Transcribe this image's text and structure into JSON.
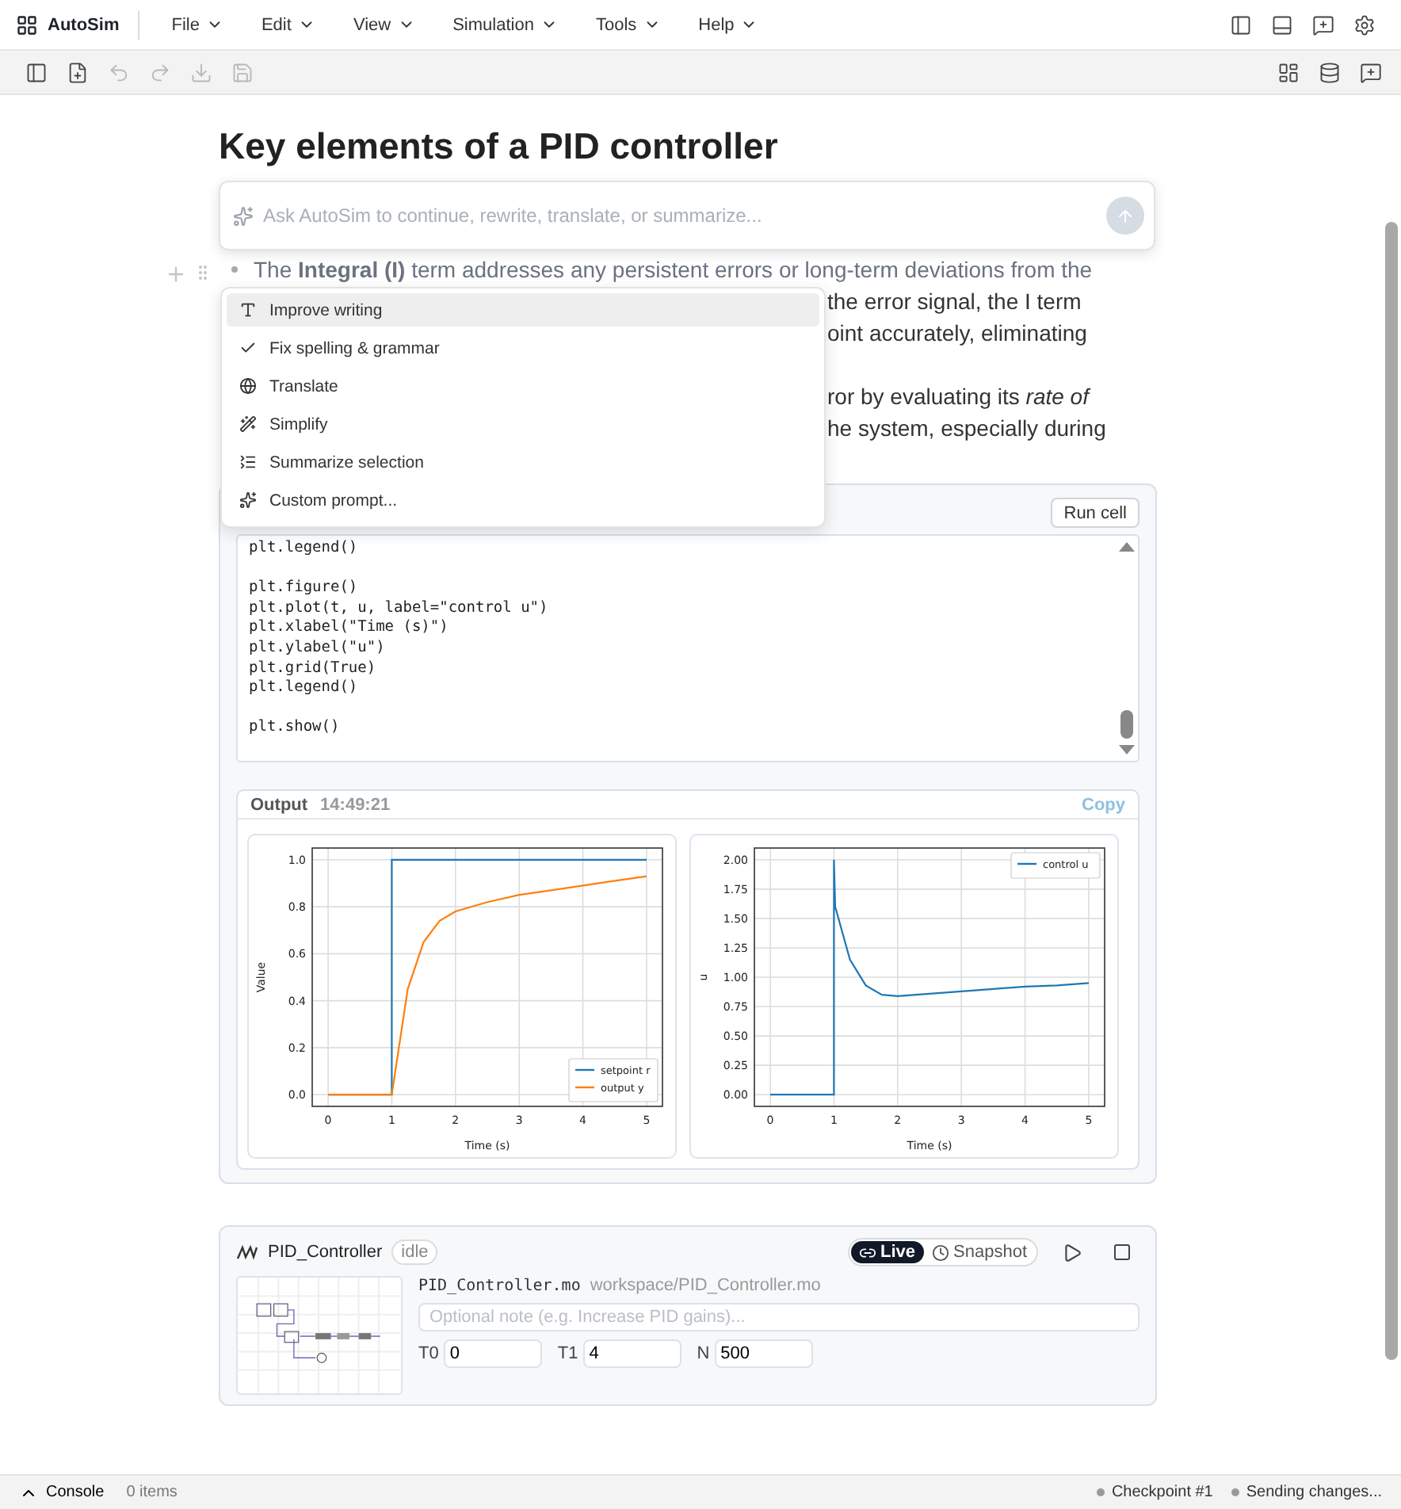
{
  "app": {
    "name": "AutoSim"
  },
  "menus": [
    "File",
    "Edit",
    "View",
    "Simulation",
    "Tools",
    "Help"
  ],
  "title_bar_actions": [
    {
      "kind": "panel-left"
    },
    {
      "kind": "panel-bottom"
    },
    {
      "kind": "chat"
    },
    {
      "kind": "settings"
    }
  ],
  "toolbar_left": [
    {
      "kind": "sidebar",
      "disabled": false
    },
    {
      "kind": "new-file",
      "disabled": false
    },
    {
      "kind": "undo",
      "disabled": true
    },
    {
      "kind": "redo",
      "disabled": true
    },
    {
      "kind": "download",
      "disabled": true
    },
    {
      "kind": "save",
      "disabled": true
    }
  ],
  "toolbar_right": [
    {
      "kind": "layout"
    },
    {
      "kind": "database"
    },
    {
      "kind": "chat"
    }
  ],
  "document": {
    "title": "Key elements of a PID controller",
    "lines": [
      {
        "kind": "bullet",
        "text": "The **Integral (I)** term addresses any persistent errors or long-term deviations from the"
      },
      {
        "kind": "fragment",
        "text": "the error signal, the I term"
      },
      {
        "kind": "fragment",
        "text": "oint accurately, eliminating"
      },
      {
        "kind": "gap"
      },
      {
        "kind": "fragment",
        "text": "ror by evaluating its *rate of*"
      },
      {
        "kind": "fragment",
        "text": "he system, especially during"
      }
    ]
  },
  "ai_prompt": {
    "placeholder": "Ask AutoSim to continue, rewrite, translate, or summarize..."
  },
  "ai_menu": [
    {
      "kind": "improve",
      "label": "Improve writing",
      "selected": true
    },
    {
      "kind": "spelling",
      "label": "Fix spelling & grammar",
      "selected": false
    },
    {
      "kind": "translate",
      "label": "Translate",
      "selected": false
    },
    {
      "kind": "simplify",
      "label": "Simplify",
      "selected": false
    },
    {
      "kind": "summarize",
      "label": "Summarize selection",
      "selected": false
    },
    {
      "kind": "custom",
      "label": "Custom prompt...",
      "selected": false
    }
  ],
  "code_cell": {
    "run_button": "Run cell",
    "code_blocks": [
      [
        "plt.legend()"
      ],
      [
        "plt.figure()",
        "plt.plot(t, u, label=\"control u\")",
        "plt.xlabel(\"Time (s)\")",
        "plt.ylabel(\"u\")",
        "plt.grid(True)",
        "plt.legend()"
      ],
      [
        "plt.show()"
      ]
    ],
    "output": {
      "label": "Output",
      "time": "14:49:21",
      "copy": "Copy",
      "charts": [
        {
          "chart_data": {
            "type": "line",
            "xlabel": "Time (s)",
            "ylabel": "Value",
            "x": [
              0,
              0.5,
              1,
              1,
              1.25,
              1.5,
              1.75,
              2,
              2.5,
              3,
              3.5,
              4,
              4.5,
              5
            ],
            "series": [
              {
                "name": "setpoint r",
                "color": "#1f77b4",
                "values": [
                  0,
                  0,
                  0,
                  1,
                  1,
                  1,
                  1,
                  1,
                  1,
                  1,
                  1,
                  1,
                  1,
                  1
                ]
              },
              {
                "name": "output y",
                "color": "#ff7f0e",
                "values": [
                  0,
                  0,
                  0,
                  0,
                  0.45,
                  0.65,
                  0.74,
                  0.78,
                  0.82,
                  0.85,
                  0.87,
                  0.89,
                  0.91,
                  0.93
                ]
              }
            ],
            "grid": true,
            "legend": "lower right",
            "xlim": [
              -0.25,
              5.25
            ],
            "ylim": [
              -0.05,
              1.05
            ],
            "xticks": [
              0,
              1,
              2,
              3,
              4,
              5
            ],
            "yticks": [
              {
                "value": 0,
                "label": "0.0"
              },
              {
                "value": 0.2,
                "label": "0.2"
              },
              {
                "value": 0.4,
                "label": "0.4"
              },
              {
                "value": 0.6,
                "label": "0.6"
              },
              {
                "value": 0.8,
                "label": "0.8"
              },
              {
                "value": 1,
                "label": "1.0"
              }
            ]
          }
        },
        {
          "chart_data": {
            "type": "line",
            "xlabel": "Time (s)",
            "ylabel": "u",
            "x": [
              0,
              0.5,
              1,
              1,
              1.02,
              1.25,
              1.5,
              1.75,
              2,
              2.5,
              3,
              3.5,
              4,
              4.5,
              5
            ],
            "series": [
              {
                "name": "control u",
                "color": "#1f77b4",
                "values": [
                  0,
                  0,
                  0,
                  2,
                  1.6,
                  1.15,
                  0.93,
                  0.85,
                  0.84,
                  0.86,
                  0.88,
                  0.9,
                  0.92,
                  0.93,
                  0.95
                ]
              }
            ],
            "grid": true,
            "legend": "upper right",
            "xlim": [
              -0.25,
              5.25
            ],
            "ylim": [
              -0.1,
              2.1
            ],
            "xticks": [
              0,
              1,
              2,
              3,
              4,
              5
            ],
            "yticks": [
              {
                "value": 0,
                "label": "0.00"
              },
              {
                "value": 0.25,
                "label": "0.25"
              },
              {
                "value": 0.5,
                "label": "0.50"
              },
              {
                "value": 0.75,
                "label": "0.75"
              },
              {
                "value": 1,
                "label": "1.00"
              },
              {
                "value": 1.25,
                "label": "1.25"
              },
              {
                "value": 1.5,
                "label": "1.50"
              },
              {
                "value": 1.75,
                "label": "1.75"
              },
              {
                "value": 2,
                "label": "2.00"
              }
            ]
          }
        }
      ]
    }
  },
  "model": {
    "name": "PID_Controller",
    "status": "idle",
    "modes": [
      {
        "label": "Live",
        "kind": "live",
        "selected": true
      },
      {
        "label": "Snapshot",
        "kind": "snapshot",
        "selected": false
      }
    ],
    "file": "PID_Controller.mo",
    "path": "workspace/PID_Controller.mo",
    "note": {
      "placeholder": "Optional note (e.g. Increase PID gains)..."
    },
    "params": [
      {
        "label": "T0",
        "value": "0"
      },
      {
        "label": "T1",
        "value": "4"
      },
      {
        "label": "N",
        "value": "500"
      }
    ]
  },
  "status_bar": {
    "console": "Console",
    "items": "0 items",
    "right": [
      {
        "label": "Checkpoint #1"
      },
      {
        "label": "Sending changes..."
      }
    ]
  }
}
